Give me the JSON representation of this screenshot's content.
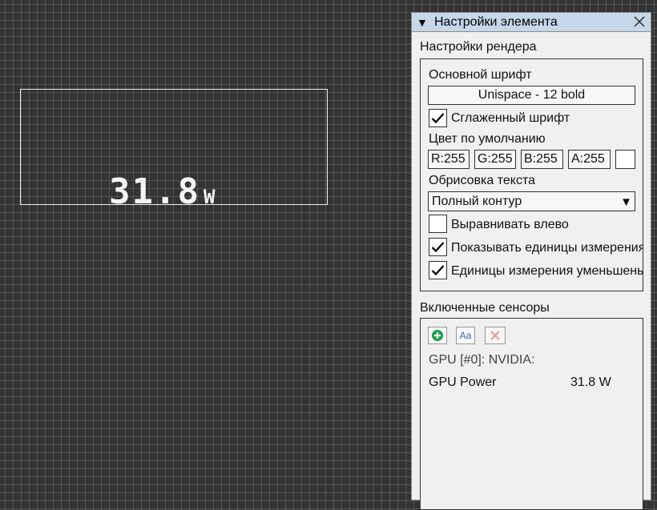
{
  "canvas": {
    "value": "31.8",
    "unit": "W"
  },
  "panel": {
    "title": "Настройки элемента",
    "render_section": {
      "label": "Настройки рендера",
      "main_font_label": "Основной шрифт",
      "main_font_value": "Unispace - 12 bold",
      "smooth_font_label": "Сглаженный шрифт",
      "smooth_font_checked": true,
      "default_color_label": "Цвет по умолчанию",
      "color_r": "R:255",
      "color_g": "G:255",
      "color_b": "B:255",
      "color_a": "A:255",
      "swatch_color": "#ffffff",
      "outline_label": "Обрисовка текста",
      "outline_value": "Полный контур",
      "align_left_label": "Выравнивать влево",
      "align_left_checked": false,
      "show_units_label": "Показывать единицы измерения",
      "show_units_checked": true,
      "shrink_units_label": "Единицы измерения уменьшены",
      "shrink_units_checked": true
    },
    "sensors_section": {
      "label": "Включенные сенсоры",
      "group_name": "GPU [#0]: NVIDIA:",
      "rows": [
        {
          "name": "GPU Power",
          "value": "31.8 W"
        }
      ]
    }
  }
}
